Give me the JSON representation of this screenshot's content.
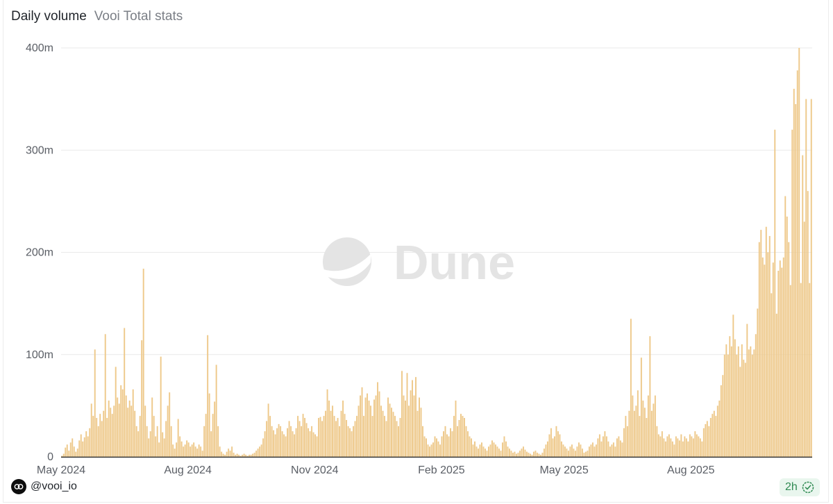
{
  "header": {
    "title": "Daily volume",
    "subtitle": "Vooi Total stats"
  },
  "watermark": "Dune",
  "footer": {
    "handle": "@vooi_io",
    "refresh": "2h"
  },
  "colors": {
    "bar": "#eec98b",
    "grid": "#e9e9e9",
    "axis": "#333333",
    "tick_text": "#5a5e65",
    "watermark": "#e4e4e4",
    "status_green": "#2f8a52"
  },
  "chart_data": {
    "type": "bar",
    "x_start": "2024-05-01",
    "x_end": "2025-10-28",
    "ylim": [
      0,
      400
    ],
    "y_ticks": [
      0,
      100,
      200,
      300,
      400
    ],
    "y_tick_labels": [
      "0",
      "100m",
      "200m",
      "300m",
      "400m"
    ],
    "x_ticks": [
      "2024-05-01",
      "2024-08-01",
      "2024-11-01",
      "2025-02-01",
      "2025-05-01",
      "2025-08-01"
    ],
    "x_tick_labels": [
      "May 2024",
      "Aug 2024",
      "Nov 2024",
      "Feb 2025",
      "May 2025",
      "Aug 2025"
    ],
    "grid": true,
    "series": [
      {
        "values": [
          1,
          3,
          9,
          12,
          6,
          14,
          18,
          10,
          5,
          8,
          16,
          22,
          15,
          19,
          25,
          20,
          28,
          52,
          40,
          105,
          38,
          30,
          42,
          35,
          45,
          120,
          38,
          55,
          48,
          42,
          50,
          88,
          58,
          52,
          70,
          66,
          126,
          60,
          48,
          55,
          50,
          66,
          45,
          30,
          25,
          40,
          114,
          184,
          50,
          30,
          18,
          25,
          58,
          40,
          20,
          30,
          14,
          98,
          24,
          18,
          35,
          50,
          63,
          30,
          12,
          8,
          14,
          37,
          20,
          15,
          10,
          12,
          16,
          14,
          10,
          12,
          14,
          10,
          8,
          12,
          10,
          6,
          30,
          42,
          119,
          62,
          25,
          42,
          54,
          90,
          30,
          10,
          5,
          3,
          2,
          5,
          8,
          6,
          10,
          4,
          2,
          3,
          2,
          1,
          2,
          3,
          2,
          1,
          2,
          2,
          3,
          4,
          6,
          8,
          10,
          12,
          18,
          25,
          35,
          52,
          40,
          30,
          26,
          22,
          28,
          32,
          30,
          25,
          22,
          20,
          28,
          35,
          30,
          25,
          22,
          28,
          40,
          35,
          30,
          42,
          38,
          33,
          28,
          25,
          30,
          24,
          22,
          20,
          38,
          39,
          35,
          40,
          45,
          66,
          55,
          45,
          50,
          40,
          35,
          38,
          30,
          45,
          55,
          42,
          36,
          30,
          28,
          25,
          30,
          35,
          40,
          50,
          60,
          68,
          40,
          58,
          62,
          55,
          50,
          40,
          56,
          60,
          73,
          64,
          50,
          45,
          40,
          35,
          58,
          52,
          48,
          44,
          40,
          35,
          30,
          38,
          84,
          60,
          55,
          82,
          50,
          65,
          75,
          60,
          78,
          45,
          58,
          48,
          30,
          20,
          18,
          12,
          10,
          12,
          14,
          20,
          18,
          15,
          12,
          20,
          25,
          30,
          22,
          20,
          28,
          25,
          40,
          55,
          30,
          36,
          42,
          40,
          38,
          30,
          25,
          20,
          18,
          12,
          15,
          10,
          8,
          12,
          14,
          10,
          8,
          6,
          10,
          12,
          16,
          14,
          12,
          10,
          8,
          6,
          14,
          20,
          15,
          10,
          8,
          6,
          4,
          5,
          3,
          4,
          6,
          8,
          10,
          7,
          5,
          4,
          3,
          2,
          5,
          6,
          4,
          3,
          2,
          4,
          8,
          12,
          15,
          22,
          28,
          18,
          20,
          30,
          25,
          22,
          15,
          12,
          10,
          8,
          6,
          10,
          12,
          8,
          6,
          10,
          14,
          12,
          8,
          4,
          5,
          6,
          10,
          12,
          14,
          10,
          12,
          18,
          22,
          15,
          20,
          25,
          20,
          15,
          10,
          12,
          14,
          10,
          18,
          20,
          16,
          14,
          28,
          40,
          30,
          45,
          135,
          60,
          45,
          50,
          65,
          40,
          97,
          55,
          48,
          38,
          60,
          118,
          45,
          52,
          60,
          30,
          22,
          20,
          25,
          18,
          15,
          20,
          22,
          18,
          15,
          12,
          20,
          18,
          16,
          22,
          15,
          20,
          18,
          15,
          22,
          20,
          18,
          25,
          22,
          20,
          18,
          15,
          28,
          32,
          35,
          30,
          38,
          42,
          45,
          40,
          50,
          55,
          70,
          80,
          100,
          110,
          100,
          118,
          108,
          139,
          115,
          100,
          108,
          88,
          110,
          95,
          92,
          130,
          105,
          108,
          100,
          105,
          120,
          145,
          210,
          222,
          195,
          188,
          225,
          200,
          216,
          160,
          190,
          320,
          140,
          182,
          192,
          185,
          195,
          255,
          235,
          210,
          168,
          320,
          360,
          345,
          378,
          400,
          170,
          295,
          230,
          350,
          260,
          170,
          350
        ]
      }
    ]
  }
}
